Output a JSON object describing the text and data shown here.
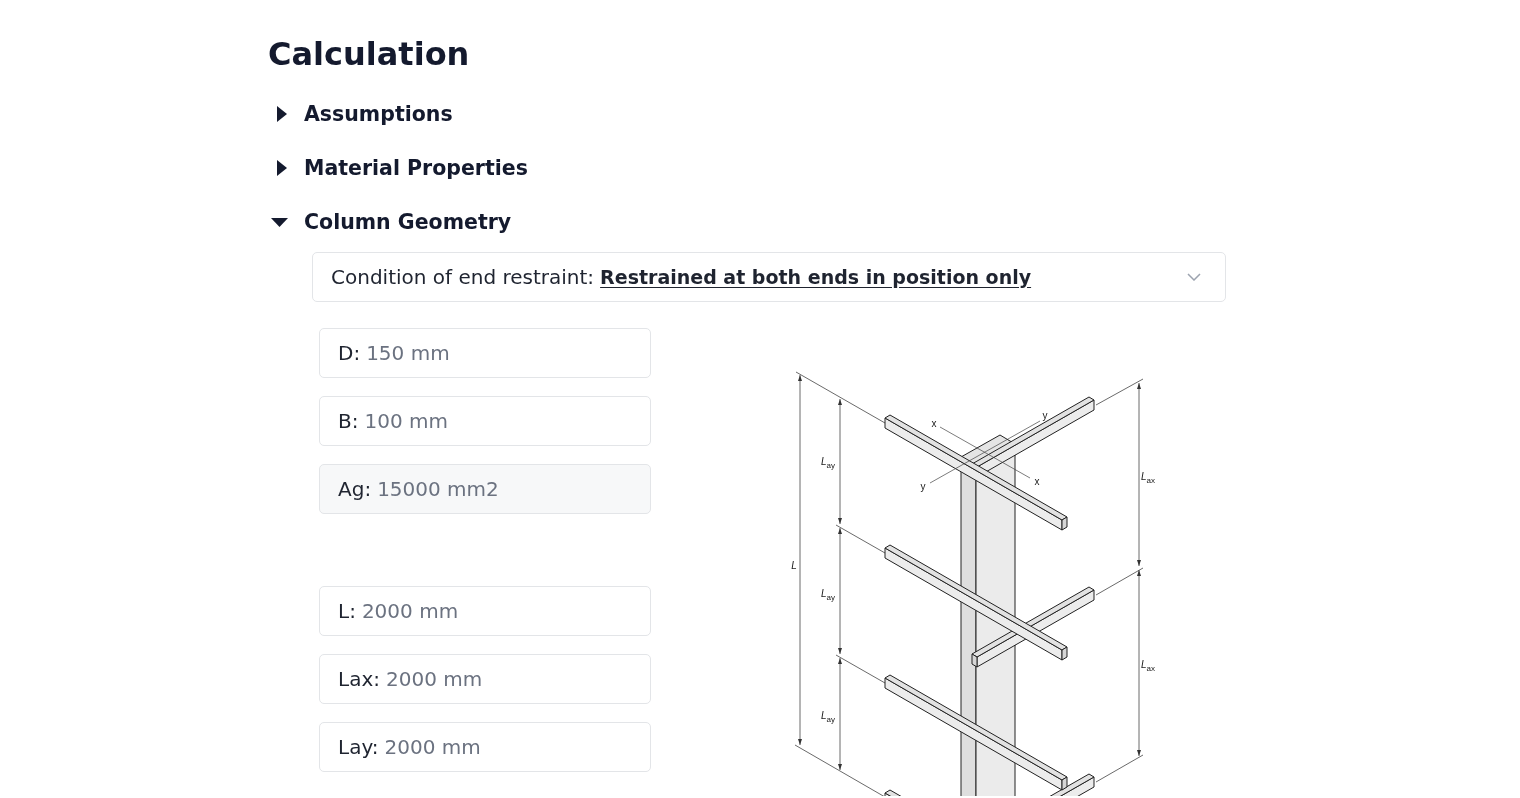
{
  "page": {
    "title": "Calculation"
  },
  "sections": [
    {
      "title": "Assumptions",
      "expanded": false
    },
    {
      "title": "Material Properties",
      "expanded": false
    },
    {
      "title": "Column Geometry",
      "expanded": true,
      "end_restraint": {
        "label": "Condition of end restraint:",
        "value": "Restrained at both ends in position only"
      },
      "field_groups": [
        [
          {
            "label": "D:",
            "value": "150 mm",
            "disabled": false
          },
          {
            "label": "B:",
            "value": "100 mm",
            "disabled": false
          },
          {
            "label": "Ag:",
            "value": "15000 mm2",
            "disabled": true
          }
        ],
        [
          {
            "label": "L:",
            "value": "2000 mm",
            "disabled": false
          },
          {
            "label": "Lax:",
            "value": "2000 mm",
            "disabled": false
          },
          {
            "label": "Lay:",
            "value": "2000 mm",
            "disabled": false
          }
        ]
      ],
      "diagram": {
        "labels": [
          {
            "kind": "axis",
            "text": "y"
          },
          {
            "kind": "axis",
            "text": "x"
          },
          {
            "kind": "dimension",
            "text": "L$_{ay}$"
          },
          {
            "kind": "dimension",
            "text": "L$_{ax}$"
          },
          {
            "kind": "axis",
            "text": "x"
          },
          {
            "kind": "axis",
            "text": "y"
          },
          {
            "kind": "dimension",
            "text": "L"
          },
          {
            "kind": "dimension",
            "text": "L$_{ay}$"
          },
          {
            "kind": "dimension",
            "text": "L$_{ax}$"
          },
          {
            "kind": "dimension",
            "text": "L$_{ay}$"
          }
        ]
      }
    }
  ]
}
